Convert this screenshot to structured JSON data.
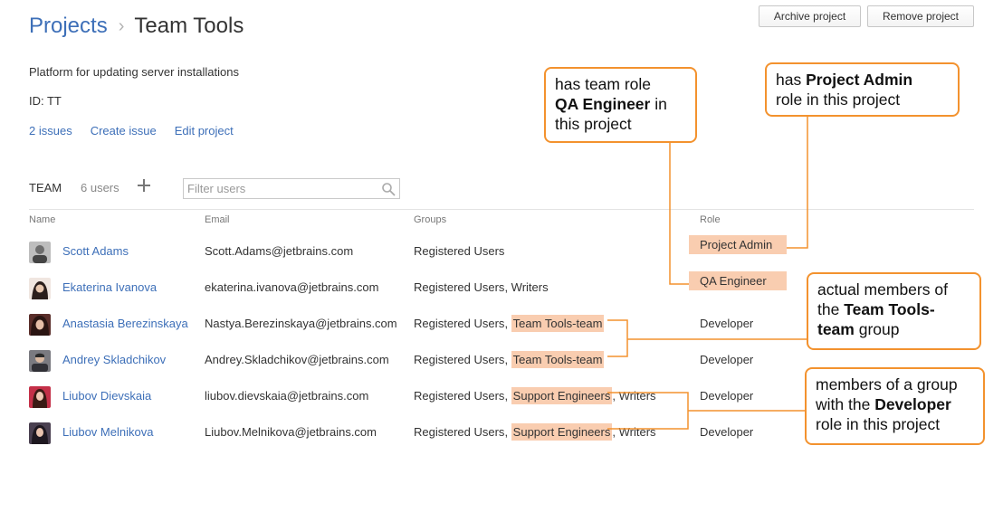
{
  "breadcrumb": {
    "root": "Projects",
    "separator": "›",
    "current": "Team Tools"
  },
  "actions": {
    "archive": "Archive project",
    "remove": "Remove project"
  },
  "project": {
    "description": "Platform for updating server installations",
    "id_label": "ID: TT"
  },
  "links": {
    "issues": "2 issues",
    "create_issue": "Create issue",
    "edit_project": "Edit project"
  },
  "team": {
    "label": "TEAM",
    "count": "6 users",
    "filter_placeholder": "Filter users"
  },
  "table": {
    "headers": {
      "name": "Name",
      "email": "Email",
      "groups": "Groups",
      "role": "Role"
    },
    "rows": [
      {
        "name": "Scott Adams",
        "email": "Scott.Adams@jetbrains.com",
        "groups": [
          "Registered Users"
        ],
        "role": "Project Admin",
        "avatar": "#6d6d6d"
      },
      {
        "name": "Ekaterina Ivanova",
        "email": "ekaterina.ivanova@jetbrains.com",
        "groups": [
          "Registered Users",
          "Writers"
        ],
        "role": "QA Engineer",
        "avatar": "#3a2a28"
      },
      {
        "name": "Anastasia Berezinskaya",
        "email": "Nastya.Berezinskaya@jetbrains.com",
        "groups": [
          "Registered Users",
          "Team Tools-team"
        ],
        "role": "Developer",
        "avatar": "#5a2e2a"
      },
      {
        "name": "Andrey Skladchikov",
        "email": "Andrey.Skladchikov@jetbrains.com",
        "groups": [
          "Registered Users",
          "Team Tools-team"
        ],
        "role": "Developer",
        "avatar": "#4a4a52"
      },
      {
        "name": "Liubov Dievskaia",
        "email": "liubov.dievskaia@jetbrains.com",
        "groups": [
          "Registered Users",
          "Support Engineers",
          "Writers"
        ],
        "role": "Developer",
        "avatar": "#8a2030"
      },
      {
        "name": "Liubov Melnikova",
        "email": "Liubov.Melnikova@jetbrains.com",
        "groups": [
          "Registered Users",
          "Support Engineers",
          "Writers"
        ],
        "role": "Developer",
        "avatar": "#3b3440"
      }
    ]
  },
  "callouts": {
    "qa": {
      "l1": "has team role",
      "l2": "QA Engineer",
      "l2b": " in",
      "l3": "this project"
    },
    "admin": {
      "l1a": "has ",
      "l1b": "Project Admin",
      "l2": "role in this project"
    },
    "team_group": {
      "l1": "actual members of",
      "l2a": "the ",
      "l2b": "Team Tools-",
      "l3a": "team",
      "l3b": " group"
    },
    "dev_group": {
      "l1": "members of  a group",
      "l2a": "with the ",
      "l2b": "Developer",
      "l3": "role in this project"
    }
  },
  "colors": {
    "link": "#3d6fb8",
    "highlight": "#f9cdb0",
    "callout_border": "#f3922e"
  }
}
